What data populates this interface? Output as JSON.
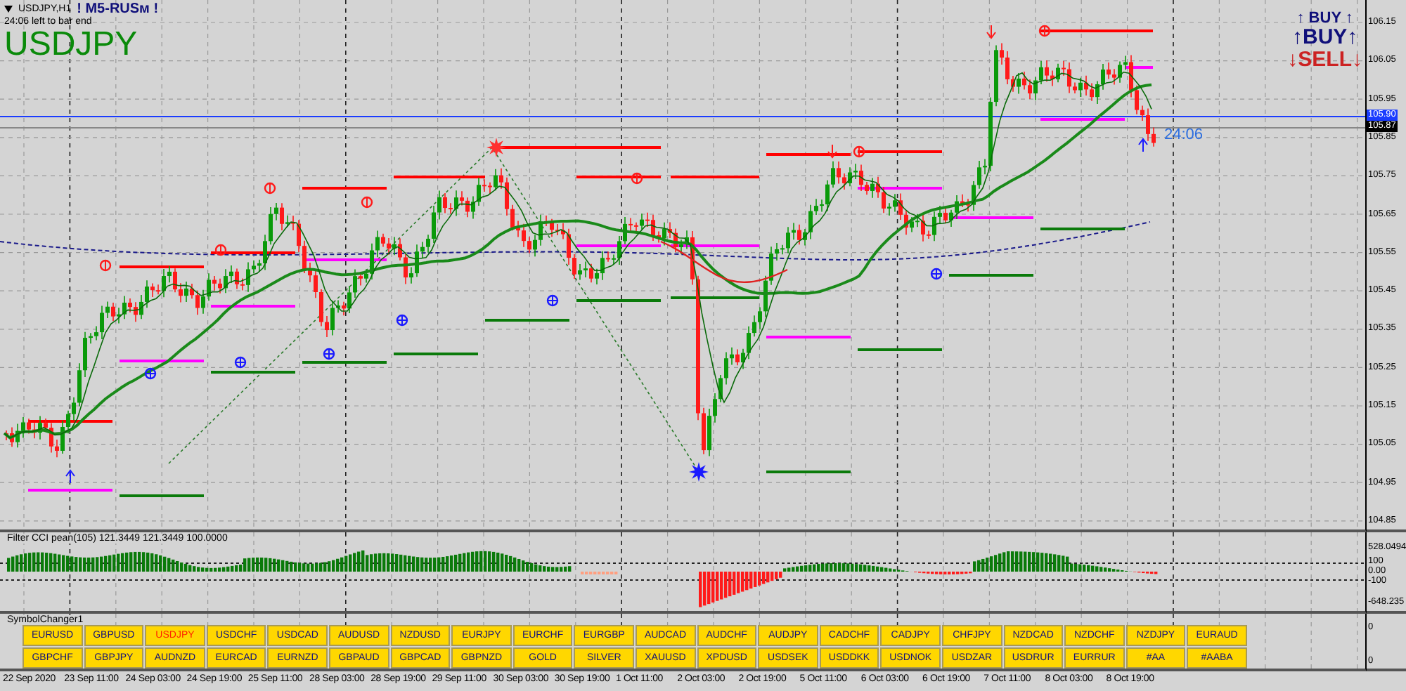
{
  "chart": {
    "symbol_timeframe": "USDJPY,H1",
    "expert_label": "! M5-RUSм !",
    "timer_text": "24:06 left to bar end",
    "symbol_title": "USDJPY",
    "countdown": "24:06",
    "signals": [
      {
        "kind": "buy",
        "text": "↑ BUY ↑"
      },
      {
        "kind": "buy_strong",
        "text": "↑BUY↑"
      },
      {
        "kind": "sell",
        "text": "↓SELL↓"
      }
    ],
    "price_axis": [
      "106.15",
      "106.05",
      "105.95",
      "105.85",
      "105.75",
      "105.65",
      "105.55",
      "105.45",
      "105.35",
      "105.25",
      "105.15",
      "105.05",
      "104.95",
      "104.85"
    ],
    "price_tags": [
      {
        "kind": "bid",
        "text": "105.90"
      },
      {
        "kind": "last",
        "text": "105.87"
      }
    ]
  },
  "indicator": {
    "title": "Filter CCI pean(105)  121.3449 121.3449 100.0000",
    "axis": [
      "528.0494",
      "100",
      "0.00",
      "-100",
      "-648.235"
    ]
  },
  "symbol_changer": {
    "title": "SymbolChanger1",
    "axis": [
      "0",
      "0"
    ],
    "button_rows": [
      {
        "buttons": [
          {
            "label": "EURUSD",
            "selected": false
          },
          {
            "label": "GBPUSD",
            "selected": false
          },
          {
            "label": "USDJPY",
            "selected": true
          },
          {
            "label": "USDCHF",
            "selected": false
          },
          {
            "label": "USDCAD",
            "selected": false
          },
          {
            "label": "AUDUSD",
            "selected": false
          },
          {
            "label": "NZDUSD",
            "selected": false
          },
          {
            "label": "EURJPY",
            "selected": false
          },
          {
            "label": "EURCHF",
            "selected": false
          },
          {
            "label": "EURGBP",
            "selected": false
          },
          {
            "label": "AUDCAD",
            "selected": false
          },
          {
            "label": "AUDCHF",
            "selected": false
          },
          {
            "label": "AUDJPY",
            "selected": false
          },
          {
            "label": "CADCHF",
            "selected": false
          },
          {
            "label": "CADJPY",
            "selected": false
          },
          {
            "label": "CHFJPY",
            "selected": false
          },
          {
            "label": "NZDCAD",
            "selected": false
          },
          {
            "label": "NZDCHF",
            "selected": false
          },
          {
            "label": "NZDJPY",
            "selected": false
          },
          {
            "label": "EURAUD",
            "selected": false
          }
        ]
      },
      {
        "buttons": [
          {
            "label": "GBPCHF",
            "selected": false
          },
          {
            "label": "GBPJPY",
            "selected": false
          },
          {
            "label": "AUDNZD",
            "selected": false
          },
          {
            "label": "EURCAD",
            "selected": false
          },
          {
            "label": "EURNZD",
            "selected": false
          },
          {
            "label": "GBPAUD",
            "selected": false
          },
          {
            "label": "GBPCAD",
            "selected": false
          },
          {
            "label": "GBPNZD",
            "selected": false
          },
          {
            "label": "GOLD",
            "selected": false
          },
          {
            "label": "SILVER",
            "selected": false
          },
          {
            "label": "XAUUSD",
            "selected": false
          },
          {
            "label": "XPDUSD",
            "selected": false
          },
          {
            "label": "USDSEK",
            "selected": false
          },
          {
            "label": "USDDKK",
            "selected": false
          },
          {
            "label": "USDNOK",
            "selected": false
          },
          {
            "label": "USDZAR",
            "selected": false
          },
          {
            "label": "USDRUR",
            "selected": false
          },
          {
            "label": "EURRUR",
            "selected": false
          },
          {
            "label": "#AA",
            "selected": false
          },
          {
            "label": "#AABA",
            "selected": false
          }
        ]
      }
    ]
  },
  "time_axis": [
    "22 Sep 2020",
    "23 Sep 11:00",
    "24 Sep 03:00",
    "24 Sep 19:00",
    "25 Sep 11:00",
    "28 Sep 03:00",
    "28 Sep 19:00",
    "29 Sep 11:00",
    "30 Sep 03:00",
    "30 Sep 19:00",
    "1 Oct 11:00",
    "2 Oct 03:00",
    "2 Oct 19:00",
    "5 Oct 11:00",
    "6 Oct 03:00",
    "6 Oct 19:00",
    "7 Oct 11:00",
    "8 Oct 03:00",
    "8 Oct 19:00"
  ]
}
